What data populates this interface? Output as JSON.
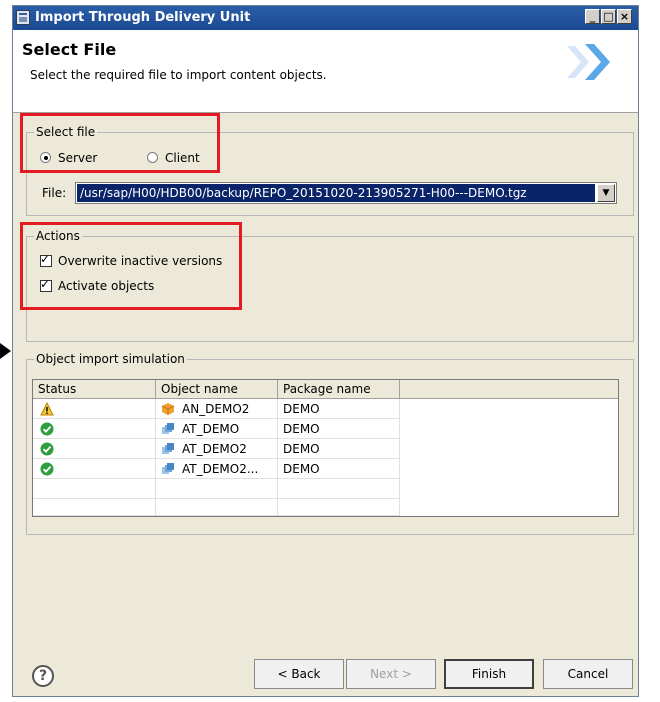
{
  "window": {
    "title": "Import Through Delivery Unit",
    "controls": {
      "minimize": "_",
      "maximize": "□",
      "close": "×"
    }
  },
  "header": {
    "title": "Select File",
    "subtitle": "Select the required file to import content objects.",
    "banner_icon": "double-chevron-right-icon"
  },
  "select_file": {
    "legend": "Select file",
    "options": [
      {
        "label": "Server",
        "checked": true
      },
      {
        "label": "Client",
        "checked": false
      }
    ],
    "file_label": "File:",
    "file_value": "/usr/sap/H00/HDB00/backup/REPO_20151020-213905271-H00---DEMO.tgz"
  },
  "actions": {
    "legend": "Actions",
    "options": [
      {
        "label": "Overwrite inactive versions",
        "checked": true
      },
      {
        "label": "Activate objects",
        "checked": true
      }
    ]
  },
  "simulation": {
    "legend": "Object import simulation",
    "columns": [
      "Status",
      "Object name",
      "Package name",
      ""
    ],
    "rows": [
      {
        "status": "warning",
        "object": "AN_DEMO2",
        "object_type": "analytic-view",
        "package": "DEMO"
      },
      {
        "status": "ok",
        "object": "AT_DEMO",
        "object_type": "attribute-view",
        "package": "DEMO"
      },
      {
        "status": "ok",
        "object": "AT_DEMO2",
        "object_type": "attribute-view",
        "package": "DEMO"
      },
      {
        "status": "ok",
        "object": "AT_DEMO2...",
        "object_type": "attribute-view",
        "package": "DEMO"
      }
    ]
  },
  "footer": {
    "help_icon": "?",
    "back": "< Back",
    "next": "Next >",
    "finish": "Finish",
    "cancel": "Cancel"
  },
  "colors": {
    "title_bar": "#1c4a92",
    "dialog_bg": "#ece9d8",
    "selection": "#0a246a",
    "annotation": "#e31c23"
  }
}
